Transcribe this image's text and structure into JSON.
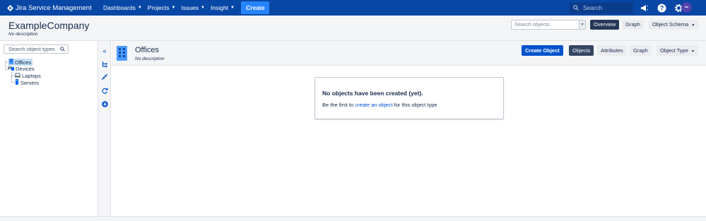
{
  "nav": {
    "brand": "Jira Service Management",
    "items": [
      {
        "label": "Dashboards"
      },
      {
        "label": "Projects"
      },
      {
        "label": "Issues"
      },
      {
        "label": "Insight"
      }
    ],
    "create_label": "Create",
    "search_placeholder": "Search",
    "avatar_text": "∞",
    "icons": [
      "megaphone-icon",
      "help-icon",
      "settings-icon",
      "avatar"
    ]
  },
  "header": {
    "title": "ExampleCompany",
    "description": "No description",
    "search_placeholder": "Search objects",
    "buttons": {
      "overview": "Overview",
      "graph": "Graph",
      "object_schema": "Object Schema"
    }
  },
  "tree": {
    "search_placeholder": "Search object types",
    "items": [
      {
        "label": "Offices",
        "selected": true,
        "icon": "building-icon"
      },
      {
        "label": "Devices",
        "selected": false,
        "icon": "devices-icon"
      },
      {
        "label": "Laptops",
        "selected": false,
        "icon": "laptop-icon"
      },
      {
        "label": "Servers",
        "selected": false,
        "icon": "server-icon"
      }
    ]
  },
  "tools": [
    "collapse-icon",
    "hierarchy-icon",
    "compress-icon",
    "refresh-icon",
    "add-icon"
  ],
  "main": {
    "title": "Offices",
    "description": "No description",
    "buttons": {
      "create_object": "Create Object",
      "objects": "Objects",
      "attributes": "Attributes",
      "graph": "Graph",
      "object_type": "Object Type"
    },
    "empty": {
      "heading": "No objects have been created (yet).",
      "text_before": "Be the first to ",
      "link": "create an object",
      "text_after": " for this object type"
    }
  },
  "colors": {
    "nav_bg": "#0747a6",
    "primary": "#0052cc",
    "create": "#2684ff",
    "active_tab": "#344563"
  }
}
